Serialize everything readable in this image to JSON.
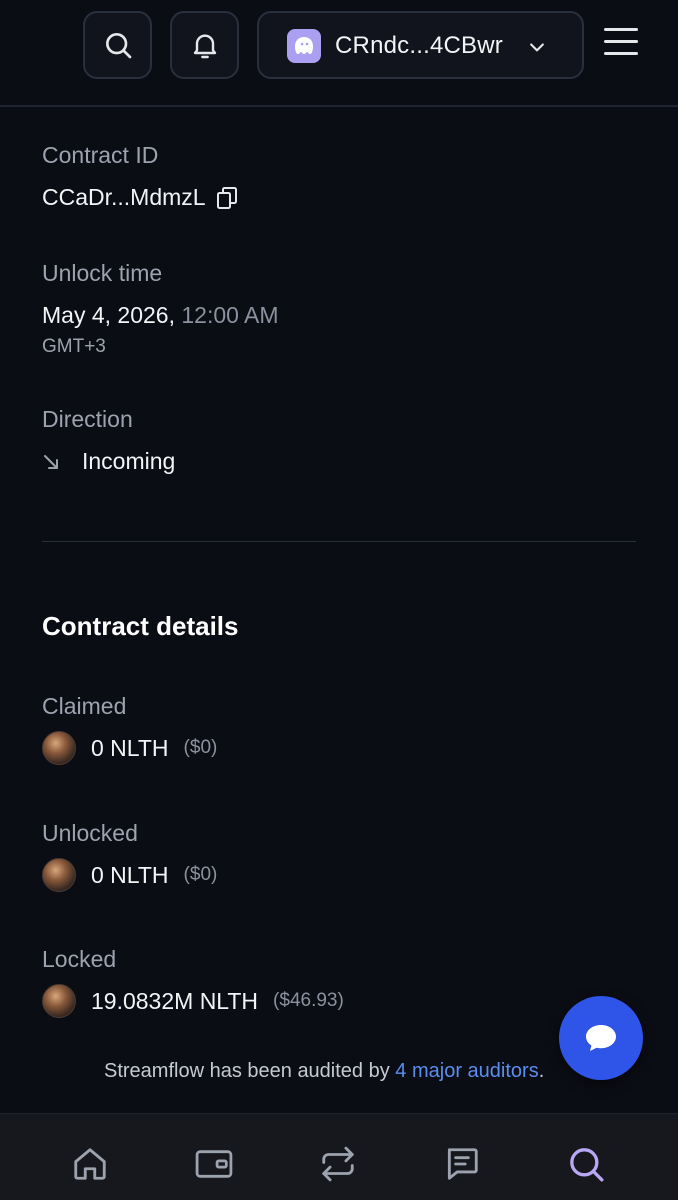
{
  "header": {
    "wallet_address": "CRndc...4CBwr",
    "icons": [
      "search-icon",
      "bell-icon",
      "wallet-ghost-icon",
      "chevron-down-icon",
      "hamburger-menu-icon"
    ]
  },
  "contract": {
    "id_label": "Contract ID",
    "id_value": "CCaDr...MdmzL",
    "unlock_label": "Unlock time",
    "unlock_date": "May 4, 2026,",
    "unlock_time": "12:00 AM",
    "unlock_tz": "GMT+3",
    "direction_label": "Direction",
    "direction_value": "Incoming"
  },
  "details": {
    "title": "Contract details",
    "claimed_label": "Claimed",
    "claimed_amount": "0 NLTH",
    "claimed_usd": "($0)",
    "unlocked_label": "Unlocked",
    "unlocked_amount": "0 NLTH",
    "unlocked_usd": "($0)",
    "locked_label": "Locked",
    "locked_amount": "19.0832M NLTH",
    "locked_usd": "($46.93)"
  },
  "footer": {
    "audit_prefix": "Streamflow has been audited by ",
    "audit_link": "4 major auditors",
    "audit_suffix": "."
  },
  "bottom_nav": {
    "icons": [
      "home-icon",
      "wallet-icon",
      "swap-icon",
      "message-icon",
      "search-icon"
    ]
  },
  "colors": {
    "background": "#0b0d14",
    "accent_blue": "#2f55e8",
    "link_blue": "#5b8def",
    "active_nav": "#b9a7f5",
    "wallet_purple": "#ab9ff2"
  }
}
